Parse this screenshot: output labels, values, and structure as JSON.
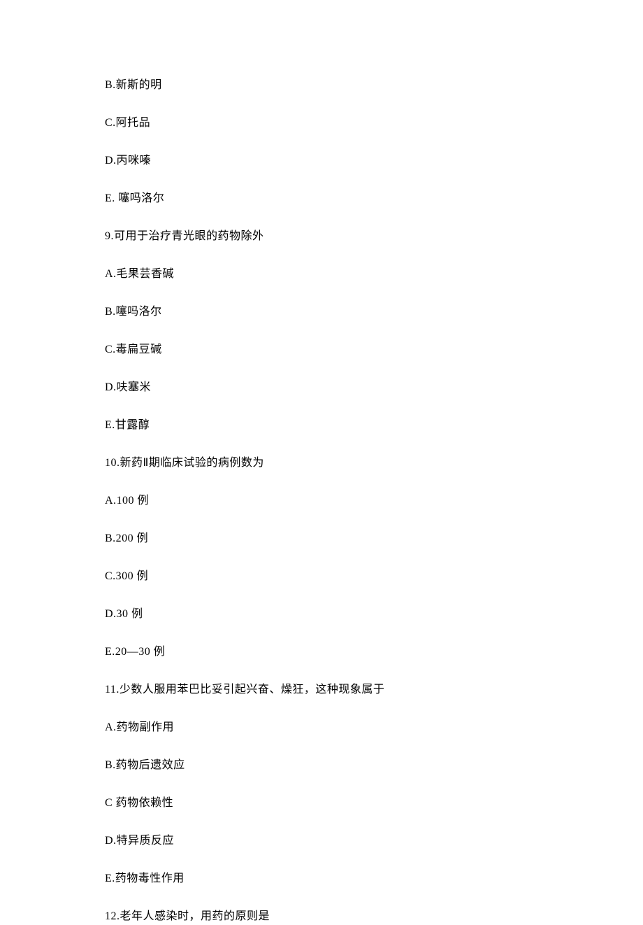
{
  "lines": [
    "B.新斯的明",
    "C.阿托品",
    "D.丙咪嗪",
    "E. 噻吗洛尔",
    "9.可用于治疗青光眼的药物除外",
    "A.毛果芸香碱",
    "B.噻吗洛尔",
    "C.毒扁豆碱",
    "D.呋塞米",
    "E.甘露醇",
    "10.新药Ⅱ期临床试验的病例数为",
    "A.100 例",
    "B.200 例",
    "C.300 例",
    "D.30 例",
    "E.20—30 例",
    "11.少数人服用苯巴比妥引起兴奋、燥狂，这种现象属于",
    "A.药物副作用",
    "B.药物后遗效应",
    "C 药物依赖性",
    "D.特异质反应",
    "E.药物毒性作用",
    "12.老年人感染时，用药的原则是"
  ]
}
